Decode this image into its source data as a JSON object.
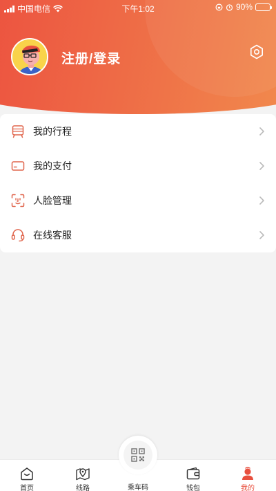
{
  "status_bar": {
    "carrier": "中国电信",
    "time": "下午1:02",
    "battery": "90%"
  },
  "profile": {
    "title": "注册/登录"
  },
  "menu": {
    "items": [
      {
        "label": "我的行程",
        "icon": "train-ticket-icon"
      },
      {
        "label": "我的支付",
        "icon": "card-icon"
      },
      {
        "label": "人脸管理",
        "icon": "face-scan-icon"
      },
      {
        "label": "在线客服",
        "icon": "headset-icon"
      }
    ]
  },
  "tabbar": {
    "tabs": [
      {
        "label": "首页",
        "icon": "home-icon"
      },
      {
        "label": "线路",
        "icon": "map-pin-icon"
      },
      {
        "label": "乘车码",
        "icon": "qr-code-icon"
      },
      {
        "label": "钱包",
        "icon": "wallet-icon"
      },
      {
        "label": "我的",
        "icon": "user-icon",
        "active": true
      }
    ]
  },
  "colors": {
    "accent": "#e8503f",
    "icon": "#e0654c"
  }
}
